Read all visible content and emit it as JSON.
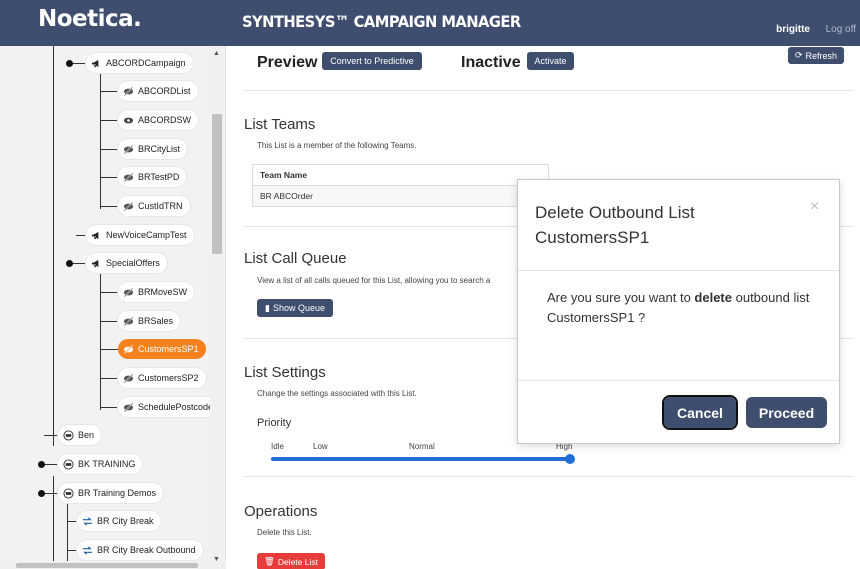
{
  "header": {
    "logo": "Noetica.",
    "app_title": "SYNTHESYS™ CAMPAIGN MANAGER",
    "user": "brigitte",
    "logoff": "Log off"
  },
  "sidebar": {
    "nodes": [
      {
        "label": "ABCORDCampaign",
        "icon": "megaphone-icon"
      },
      {
        "label": "ABCORDList",
        "icon": "eye-slash-icon"
      },
      {
        "label": "ABCORDSW",
        "icon": "eye-icon"
      },
      {
        "label": "BRCityList",
        "icon": "eye-slash-icon"
      },
      {
        "label": "BRTestPD",
        "icon": "eye-slash-icon"
      },
      {
        "label": "CustIdTRN",
        "icon": "eye-slash-icon"
      },
      {
        "label": "NewVoiceCampTest",
        "icon": "megaphone-icon"
      },
      {
        "label": "SpecialOffers",
        "icon": "megaphone-icon"
      },
      {
        "label": "BRMoveSW",
        "icon": "eye-slash-icon"
      },
      {
        "label": "BRSales",
        "icon": "eye-slash-icon"
      },
      {
        "label": "CustomersSP1",
        "icon": "eye-slash-icon",
        "active": true
      },
      {
        "label": "CustomersSP2",
        "icon": "eye-slash-icon"
      },
      {
        "label": "SchedulePostcode",
        "icon": "eye-slash-icon"
      },
      {
        "label": "Ben",
        "icon": "team-icon"
      },
      {
        "label": "BK TRAINING",
        "icon": "team-icon"
      },
      {
        "label": "BR Training Demos",
        "icon": "team-icon"
      },
      {
        "label": "BR City Break",
        "icon": "transfer-icon"
      },
      {
        "label": "BR City Break Outbound",
        "icon": "transfer-icon"
      }
    ]
  },
  "main": {
    "preview_label": "Preview",
    "convert_button": "Convert to Predictive",
    "inactive_label": "Inactive",
    "activate_button": "Activate",
    "refresh_button": "Refresh",
    "teams": {
      "title": "List Teams",
      "desc": "This List is a member of the following Teams.",
      "column": "Team Name",
      "rows": [
        "BR ABCOrder"
      ]
    },
    "queue": {
      "title": "List Call Queue",
      "desc": "View a list of all calls queued for this List, allowing you to search a",
      "button": "Show Queue"
    },
    "settings": {
      "title": "List Settings",
      "desc": "Change the settings associated with this List.",
      "priority_label": "Priority",
      "ticks": [
        "Idle",
        "Low",
        "Normal",
        "High"
      ],
      "priority_value": "High"
    },
    "operations": {
      "title": "Operations",
      "desc": "Delete this List.",
      "delete_button": "Delete List"
    }
  },
  "modal": {
    "title": "Delete Outbound List CustomersSP1",
    "close": "×",
    "body_prefix": "Are you sure you want to ",
    "body_bold": "delete",
    "body_suffix": " outbound list CustomersSP1 ?",
    "cancel": "Cancel",
    "proceed": "Proceed"
  },
  "colors": {
    "header_bg": "#3f4e6e",
    "accent_orange": "#f5821f",
    "danger_red": "#e63c3c",
    "slider_blue": "#1f6fd6"
  }
}
